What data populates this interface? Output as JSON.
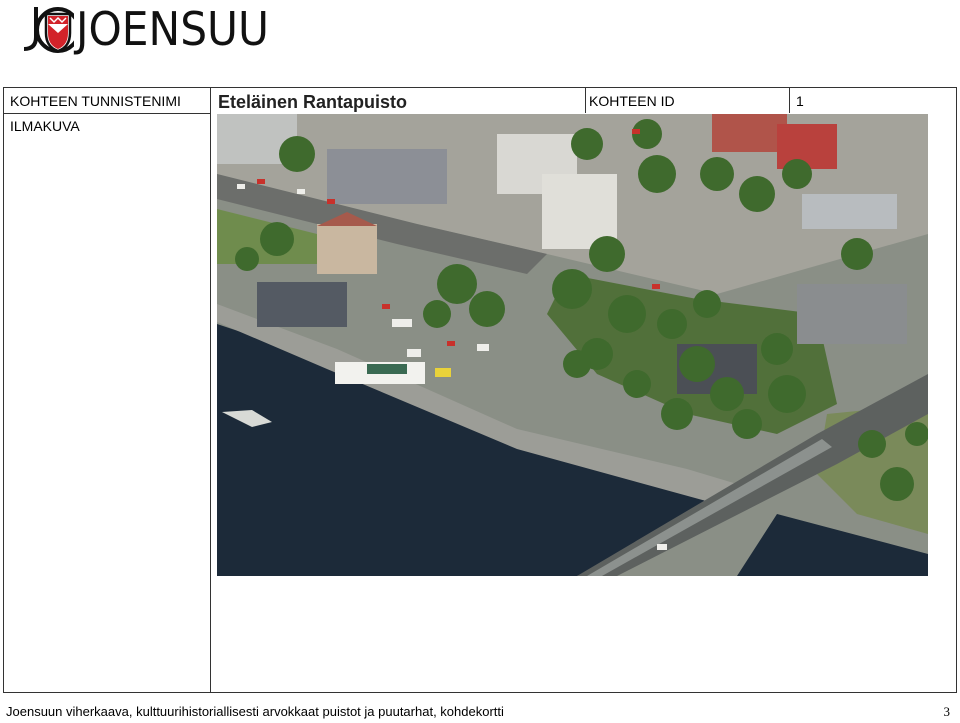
{
  "brand": {
    "logo_text": "JOENSUU"
  },
  "table": {
    "name_label": "KOHTEEN TUNNISTENIMI",
    "name_value": "Eteläinen Rantapuisto",
    "id_label": "KOHTEEN ID",
    "id_value": "1",
    "aerial_label": "ILMAKUVA"
  },
  "footer": {
    "text": "Joensuun viherkaava, kulttuurihistoriallisesti arvokkaat puistot ja puutarhat, kohdekortti",
    "page": "3"
  },
  "colors": {
    "border": "#333333",
    "logo_red": "#d2232a"
  }
}
